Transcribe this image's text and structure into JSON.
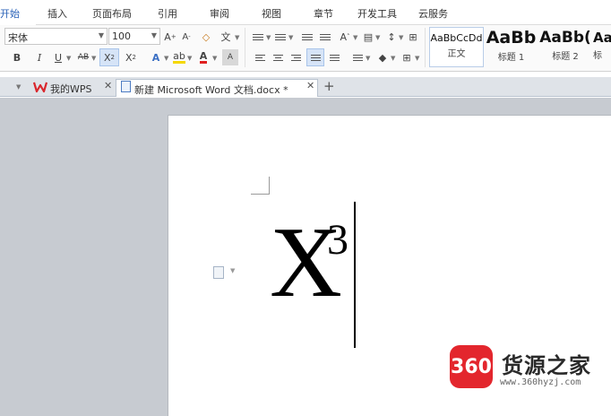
{
  "ribbon_tabs": {
    "active": "开始",
    "items": [
      "插入",
      "页面布局",
      "引用",
      "审阅",
      "视图",
      "章节",
      "开发工具",
      "云服务"
    ]
  },
  "font": {
    "family": "宋体",
    "size": "100"
  },
  "styles": {
    "items": [
      {
        "preview": "AaBbCcDd",
        "name": "正文"
      },
      {
        "preview": "AaBb",
        "name": "标题 1"
      },
      {
        "preview": "AaBb(",
        "name": "标题 2"
      },
      {
        "preview": "Aa",
        "name": "标"
      }
    ]
  },
  "doc_tabs": {
    "items": [
      {
        "label": "我的WPS",
        "icon": "wps-logo-icon"
      },
      {
        "label": "新建 Microsoft Word 文档.docx *",
        "icon": "word-document-icon",
        "active": true
      }
    ]
  },
  "document": {
    "base": "X",
    "superscript": "3"
  },
  "watermark": {
    "badge": "360",
    "title": "货源之家",
    "url": "www.360hyzj.com"
  },
  "colors": {
    "accent": "#2b63b8",
    "highlight": "#f5d800",
    "font_color": "#e02020",
    "watermark_red": "#e3262d"
  }
}
